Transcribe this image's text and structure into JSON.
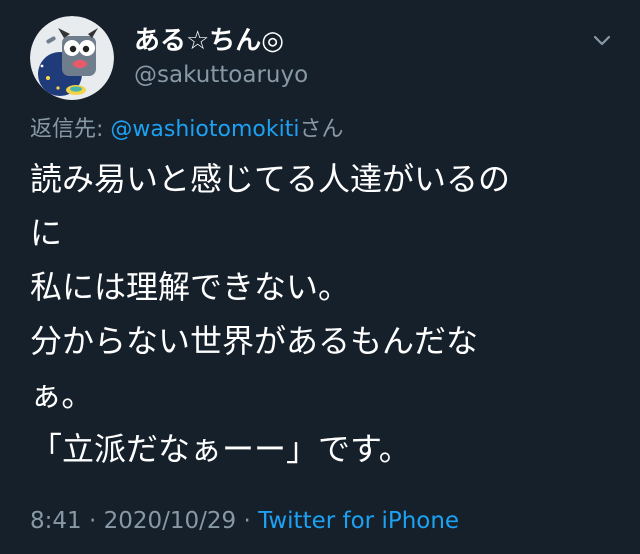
{
  "theme": {
    "background": "#15202b",
    "text_primary": "#ffffff",
    "text_secondary": "#8899a6",
    "link": "#1da1f2"
  },
  "author": {
    "display_name": "ある☆ちん◎",
    "handle": "@sakuttoaruyo",
    "avatar_icon": "avatar-illustration"
  },
  "menu_icon": "chevron-down-icon",
  "reply": {
    "prefix": "返信先: ",
    "mention": "@washiotomokiti",
    "suffix": "さん"
  },
  "tweet_lines": [
    "読み易いと感じてる人達がいるの",
    "に",
    "私には理解できない。",
    "分からない世界があるもんだな",
    "ぁ。",
    "「立派だなぁーー」です。"
  ],
  "meta": {
    "time": "8:41",
    "separator1": " · ",
    "date": "2020/10/29",
    "separator2": " · ",
    "source": "Twitter for iPhone"
  }
}
